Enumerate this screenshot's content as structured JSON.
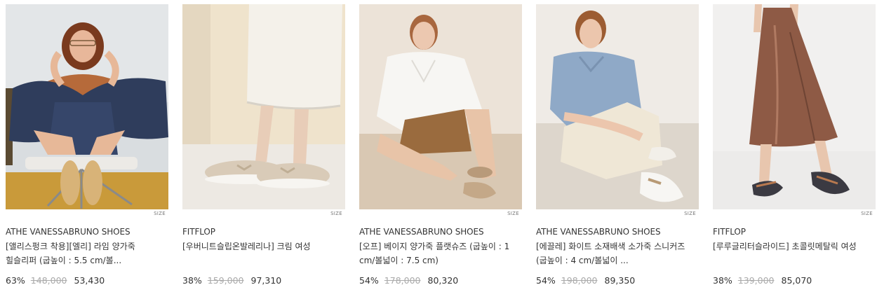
{
  "size_label": "SIZE",
  "products": [
    {
      "brand": "ATHE VANESSABRUNO SHOES",
      "title": "[앨리스펑크 착용][엘리] 라임 양가죽 힐슬리퍼 (굽높이 : 5.5 cm/볼...",
      "discount": "63%",
      "original_price": "148,000",
      "sale_price": "53,430"
    },
    {
      "brand": "FITFLOP",
      "title": "[우버니트슬립온발레리나] 크림 여성",
      "discount": "38%",
      "original_price": "159,000",
      "sale_price": "97,310"
    },
    {
      "brand": "ATHE VANESSABRUNO SHOES",
      "title": "[오프] 베이지 양가죽 플랫슈즈 (굽높이 : 1 cm/볼넓이 : 7.5 cm)",
      "discount": "54%",
      "original_price": "178,000",
      "sale_price": "80,320"
    },
    {
      "brand": "ATHE VANESSABRUNO SHOES",
      "title": "[에끌레] 화이트 소재배색 소가죽 스니커즈 (굽높이 : 4 cm/볼넓이 ...",
      "discount": "54%",
      "original_price": "198,000",
      "sale_price": "89,350"
    },
    {
      "brand": "FITFLOP",
      "title": "[루루글리터슬라이드] 초콜릿메탈릭 여성",
      "discount": "38%",
      "original_price": "139,000",
      "sale_price": "85,070"
    }
  ]
}
